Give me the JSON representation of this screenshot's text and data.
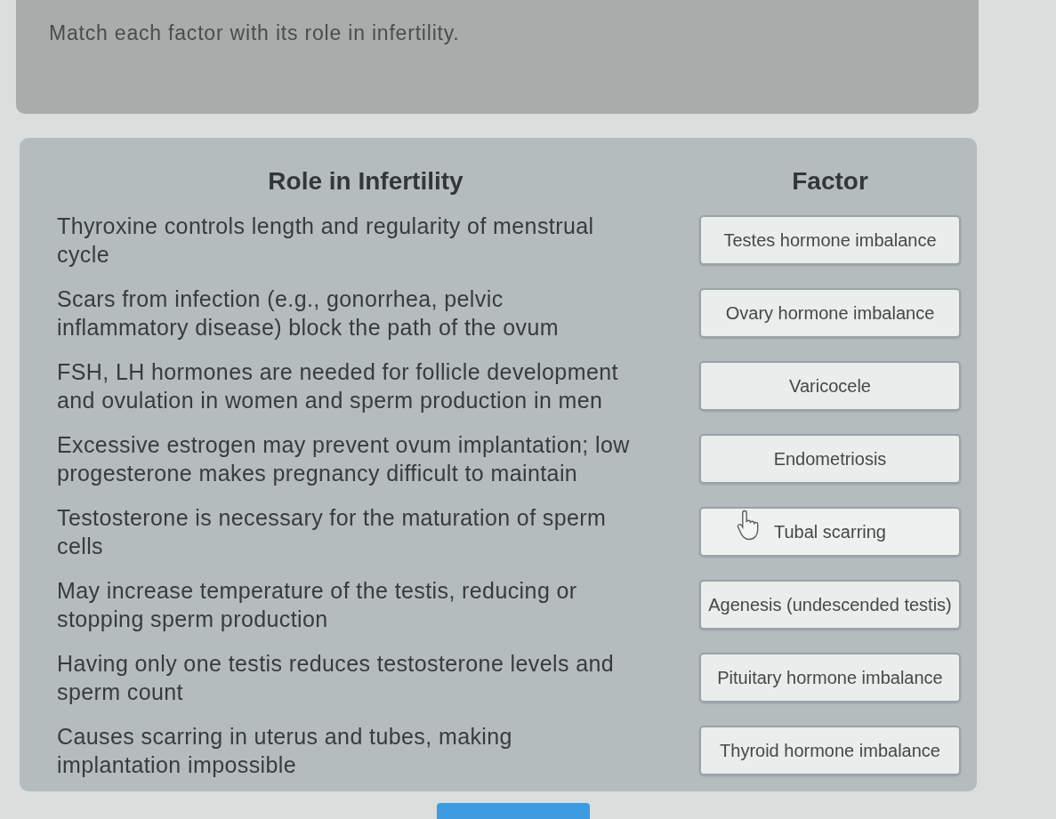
{
  "instruction": "Match each factor with its role in infertility.",
  "matching": {
    "headers": {
      "role": "Role in Infertility",
      "factor": "Factor"
    },
    "rows": [
      {
        "role": "Thyroxine controls length and regularity of menstrual cycle",
        "factor": "Testes hormone imbalance",
        "hovered": false
      },
      {
        "role": "Scars from infection (e.g., gonorrhea, pelvic inflammatory disease) block the path of the ovum",
        "factor": "Ovary hormone imbalance",
        "hovered": false
      },
      {
        "role": "FSH, LH hormones are needed for follicle development and ovulation in women and sperm production in men",
        "factor": "Varicocele",
        "hovered": false
      },
      {
        "role": "Excessive estrogen may prevent ovum implantation; low progesterone makes pregnancy difficult to maintain",
        "factor": "Endometriosis",
        "hovered": false
      },
      {
        "role": "Testosterone is necessary for the maturation of sperm cells",
        "factor": "Tubal scarring",
        "hovered": true
      },
      {
        "role": "May increase temperature of the testis, reducing or stopping sperm production",
        "factor": "Agenesis (undescended testis)",
        "hovered": false
      },
      {
        "role": "Having only one testis reduces testosterone levels and sperm count",
        "factor": "Pituitary hormone imbalance",
        "hovered": false
      },
      {
        "role": "Causes scarring in uterus and tubes, making implantation impossible",
        "factor": "Thyroid hormone imbalance",
        "hovered": false
      }
    ]
  }
}
